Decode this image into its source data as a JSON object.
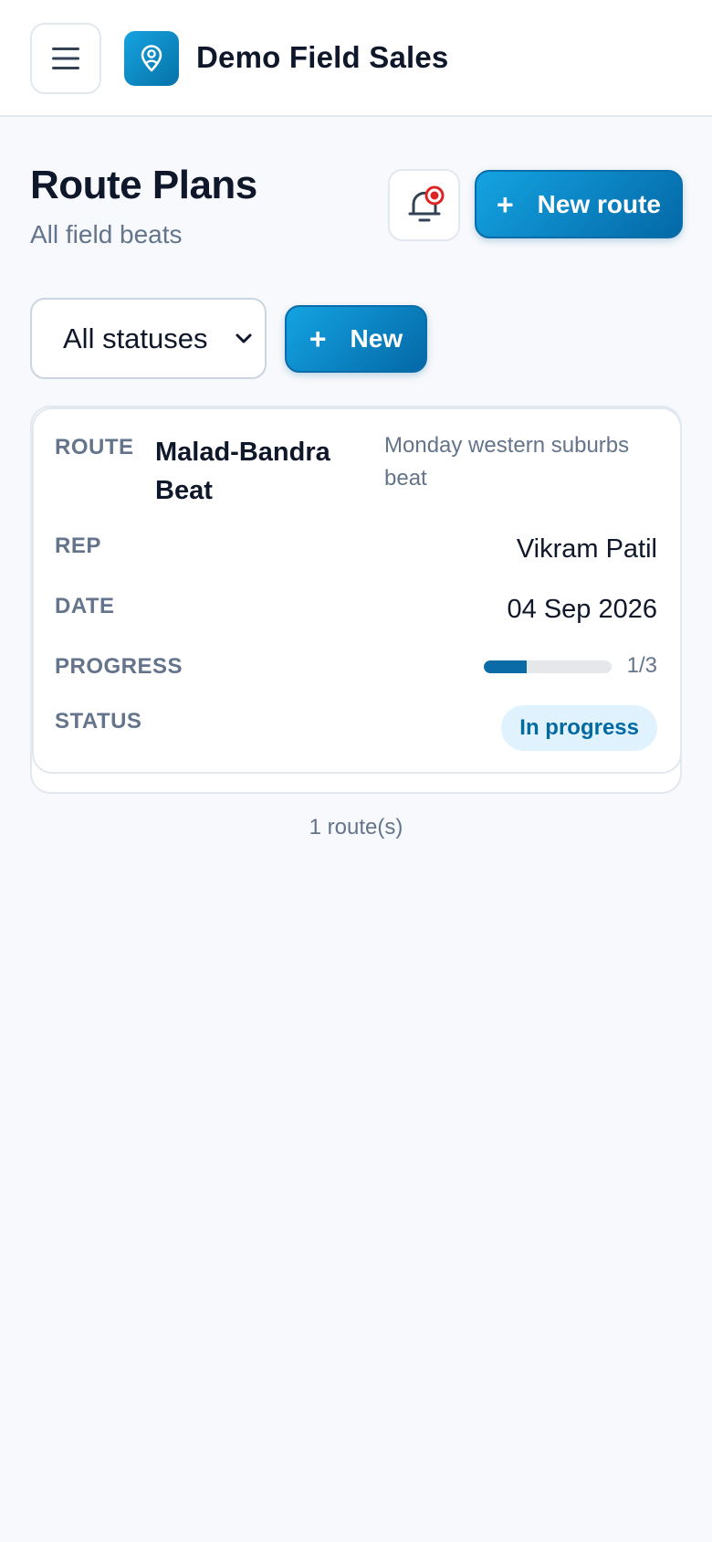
{
  "header": {
    "app_title": "Demo Field Sales",
    "menu_icon": "hamburger-menu-icon",
    "logo_icon": "map-pin-icon"
  },
  "page": {
    "title": "Route Plans",
    "subtitle": "All field beats",
    "notification_icon": "bell-icon",
    "new_route_label": "New route"
  },
  "filters": {
    "status_selected": "All statuses",
    "new_label": "New"
  },
  "route_card": {
    "labels": {
      "route": "ROUTE",
      "rep": "REP",
      "date": "DATE",
      "progress": "PROGRESS",
      "status": "STATUS"
    },
    "route_name": "Malad-Bandra Beat",
    "route_description": "Monday western suburbs beat",
    "rep": "Vikram Patil",
    "date": "04 Sep 2026",
    "progress_text": "1/3",
    "progress_fraction": 0.333,
    "status": "In progress"
  },
  "footer": {
    "count_text": "1 route(s)"
  },
  "colors": {
    "accent": "#0a6ba6",
    "accent_light": "#14a3e2",
    "badge_bg": "#e0f2fe",
    "badge_text": "#0369a1",
    "notification_dot": "#dc2626"
  }
}
